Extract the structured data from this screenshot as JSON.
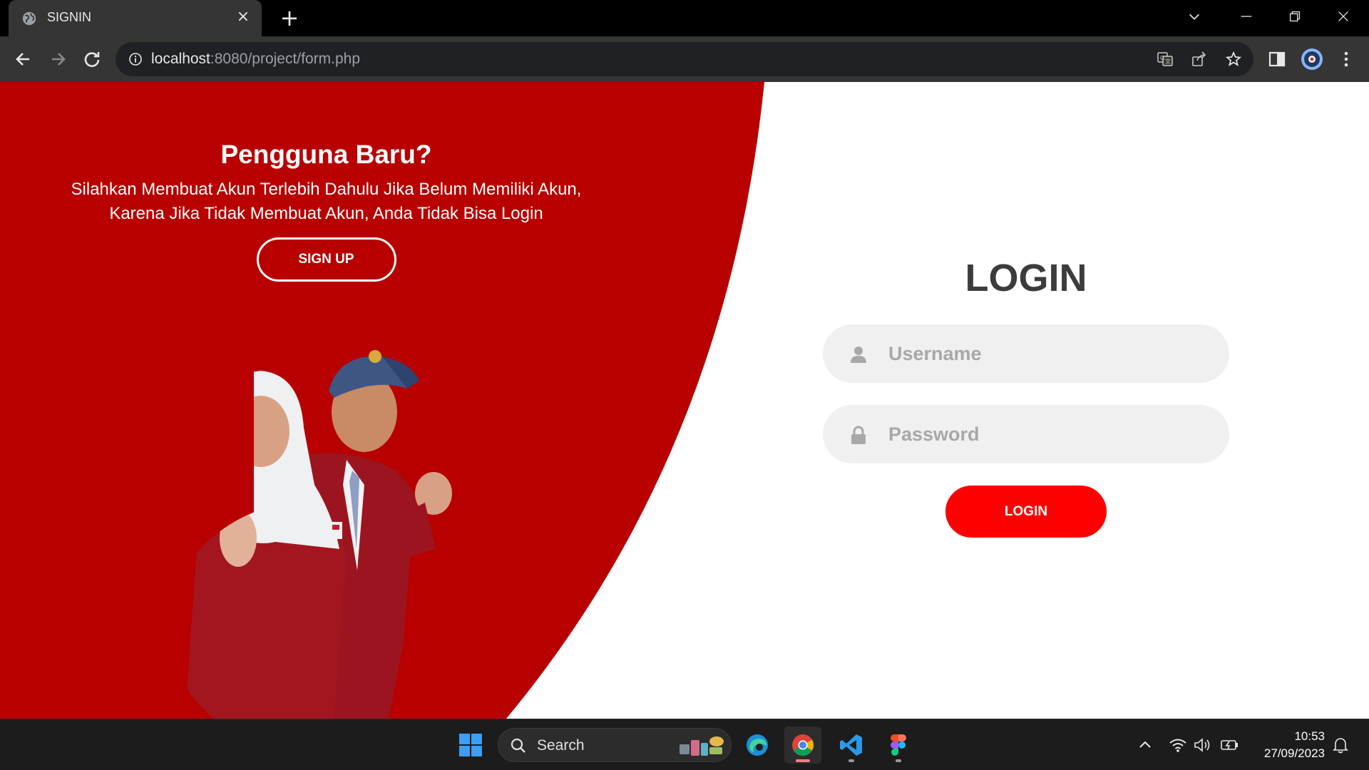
{
  "browser": {
    "tab_title": "SIGNIN",
    "tab_close": "×",
    "new_tab": "+",
    "url_host": "localhost",
    "url_path": ":8080/project/form.php"
  },
  "page": {
    "left": {
      "title": "Pengguna Baru?",
      "text": "Silahkan Membuat Akun Terlebih Dahulu Jika Belum Memiliki Akun, Karena Jika Tidak Membuat Akun, Anda Tidak Bisa Login",
      "signup_label": "SIGN UP"
    },
    "right": {
      "title": "LOGIN",
      "username_placeholder": "Username",
      "password_placeholder": "Password",
      "login_label": "LOGIN"
    },
    "colors": {
      "primary_red": "#b80000",
      "button_red": "#ff0000",
      "field_bg": "#f0f0f0",
      "title_gray": "#3c3c3c"
    }
  },
  "taskbar": {
    "search_label": "Search",
    "time": "10:53",
    "date": "27/09/2023"
  }
}
